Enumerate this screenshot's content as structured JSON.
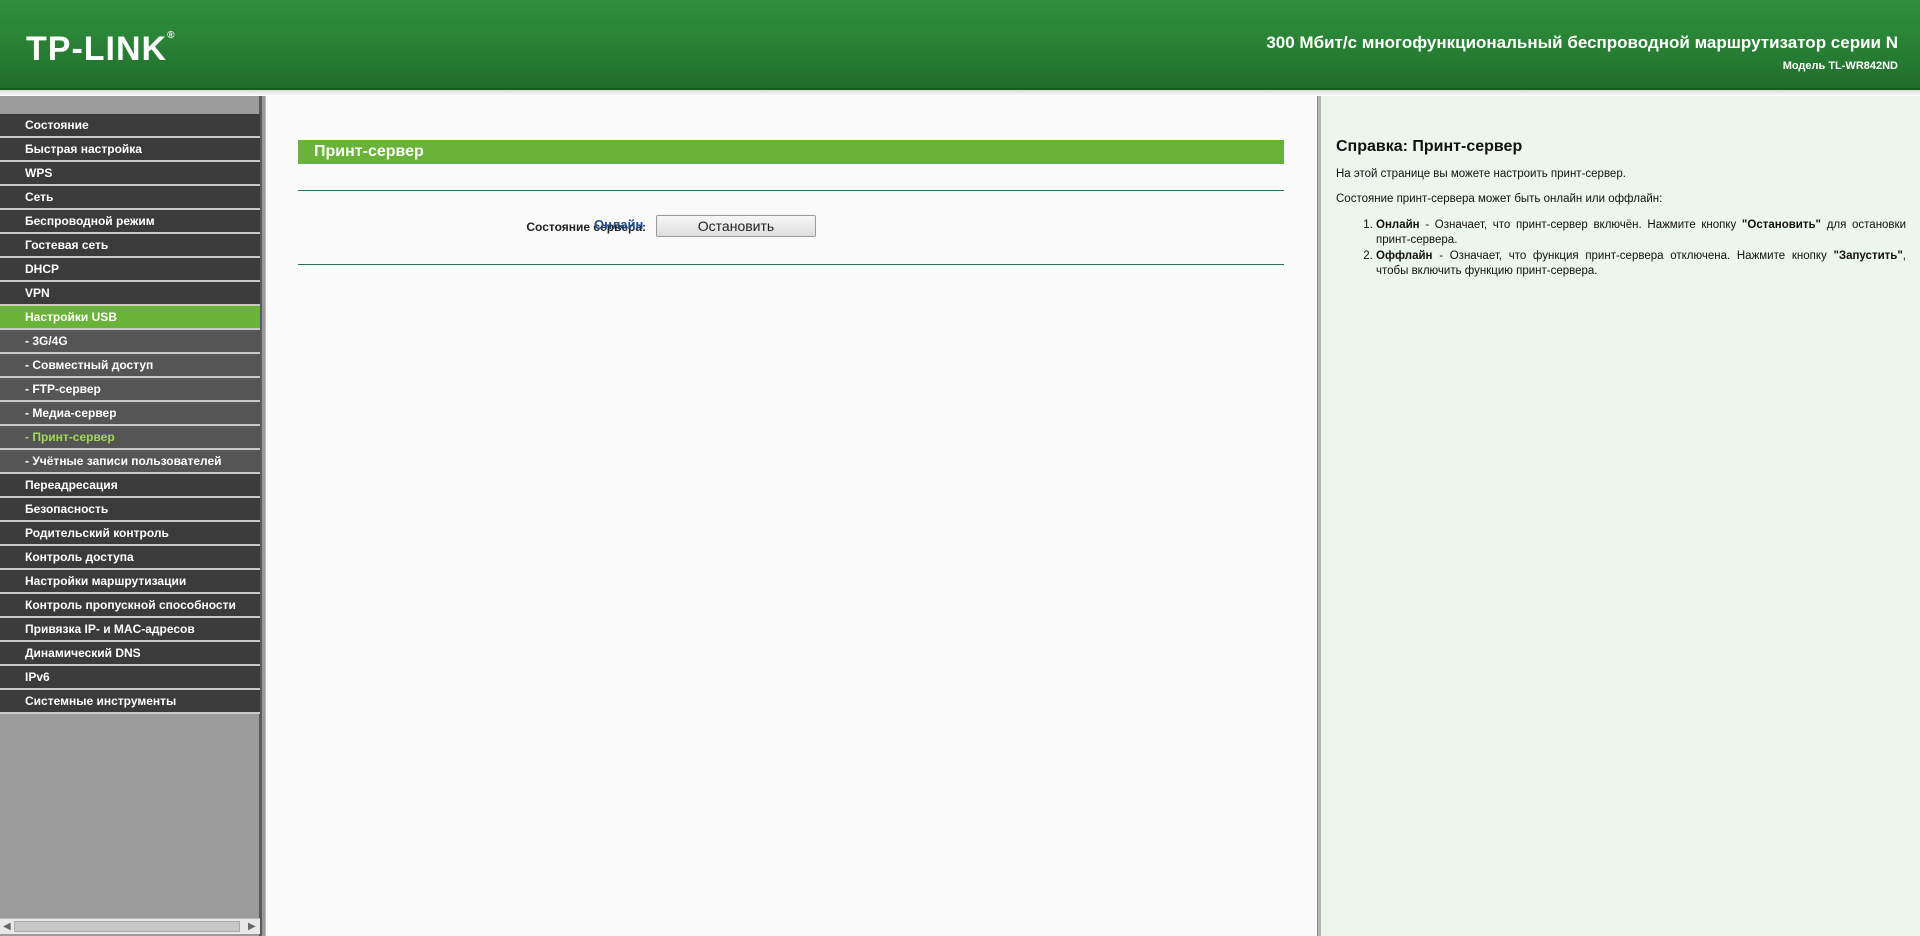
{
  "header": {
    "logo": "TP-LINK",
    "logo_mark": "®",
    "title": "300 Мбит/с многофункциональный беспроводной маршрутизатор серии N",
    "model": "Модель TL-WR842ND"
  },
  "sidebar": {
    "items": [
      {
        "label": "Состояние"
      },
      {
        "label": "Быстрая настройка"
      },
      {
        "label": "WPS"
      },
      {
        "label": "Сеть"
      },
      {
        "label": "Беспроводной режим"
      },
      {
        "label": "Гостевая сеть"
      },
      {
        "label": "DHCP"
      },
      {
        "label": "VPN"
      },
      {
        "label": "Настройки USB"
      },
      {
        "label": "- 3G/4G"
      },
      {
        "label": "- Совместный доступ"
      },
      {
        "label": "- FTP-сервер"
      },
      {
        "label": "- Медиа-сервер"
      },
      {
        "label": "- Принт-сервер"
      },
      {
        "label": "- Учётные записи пользователей"
      },
      {
        "label": "Переадресация"
      },
      {
        "label": "Безопасность"
      },
      {
        "label": "Родительский контроль"
      },
      {
        "label": "Контроль доступа"
      },
      {
        "label": "Настройки маршрутизации"
      },
      {
        "label": "Контроль пропускной способности"
      },
      {
        "label": "Привязка IP- и MAC-адресов"
      },
      {
        "label": "Динамический DNS"
      },
      {
        "label": "IPv6"
      },
      {
        "label": "Системные инструменты"
      }
    ],
    "scroll_left": "◀",
    "scroll_right": "▶"
  },
  "main": {
    "panel_title": "Принт-сервер",
    "status_label": "Состояние сервера:",
    "status_value": "Онлайн",
    "stop_button": "Остановить"
  },
  "help": {
    "title": "Справка: Принт-сервер",
    "intro": "На этой странице вы можете настроить принт-сервер.",
    "states_intro": "Состояние принт-сервера может быть онлайн или оффлайн:",
    "online_term": "Онлайн",
    "online_text": " - Означает, что принт-сервер включён. Нажмите кнопку ",
    "online_btn": "\"Остановить\"",
    "online_tail": " для остановки принт-сервера.",
    "offline_term": "Оффлайн",
    "offline_text": " - Означает, что функция принт-сервера отключена. Нажмите кнопку ",
    "offline_btn": "\"Запустить\"",
    "offline_tail": ", чтобы включить функцию принт-сервера."
  },
  "colors": {
    "header_green": "#2a8537",
    "accent_green": "#6ab339",
    "menu_dark": "#3b3b3b",
    "status_blue": "#1f4f8f",
    "help_bg": "#edf6ec"
  }
}
